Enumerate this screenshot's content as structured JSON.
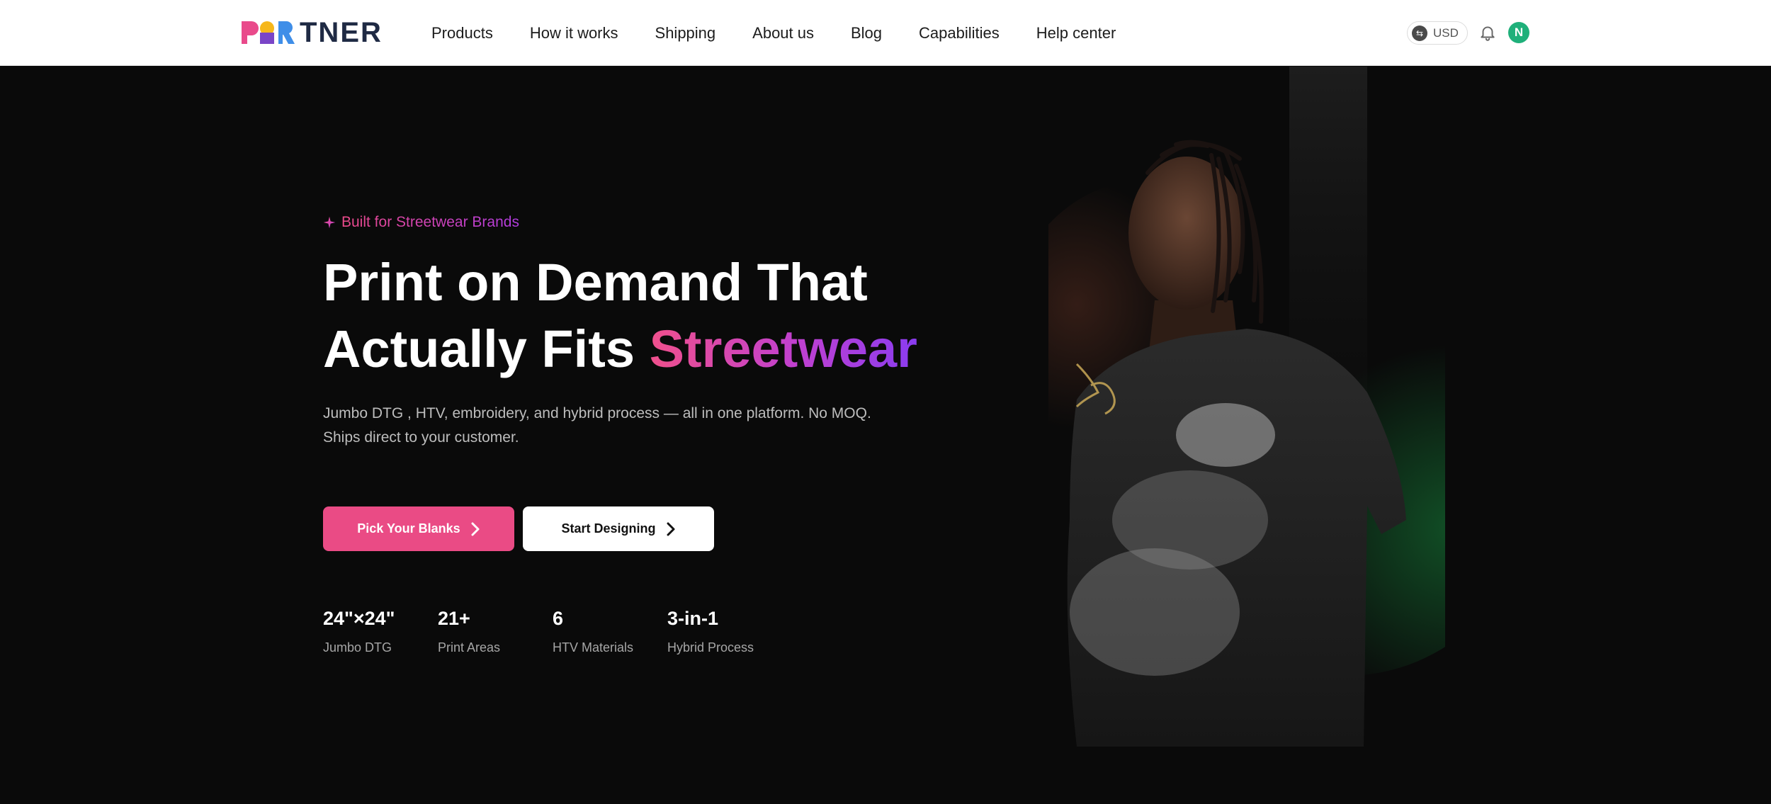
{
  "brand": {
    "name": "PARTNER",
    "wordmark": "TNER"
  },
  "nav": [
    "Products",
    "How it works",
    "Shipping",
    "About us",
    "Blog",
    "Capabilities",
    "Help center"
  ],
  "header_right": {
    "currency": "USD",
    "avatar_initial": "N"
  },
  "hero": {
    "badge": "Built for Streetwear Brands",
    "headline_line1": "Print on Demand That",
    "headline_line2_plain": "Actually Fits ",
    "headline_line2_accent": "Streetwear",
    "subtext_line1": "Jumbo DTG , HTV,  embroidery, and hybrid process — all in one platform. No MOQ.",
    "subtext_line2": "Ships direct to your customer.",
    "primary_cta": "Pick Your Blanks",
    "secondary_cta": "Start Designing",
    "stats": [
      {
        "value": "24\"×24\"",
        "label": "Jumbo DTG"
      },
      {
        "value": "21+",
        "label": "Print Areas"
      },
      {
        "value": "6",
        "label": "HTV Materials"
      },
      {
        "value": "3-in-1",
        "label": "Hybrid Process"
      }
    ]
  },
  "colors": {
    "accent_pink": "#ea4b85",
    "accent_purple": "#8a3cf0",
    "hero_bg": "#0a0a0a",
    "avatar_green": "#1fb07a"
  },
  "icons": [
    "sparkle-icon",
    "currency-exchange-icon",
    "bell-icon",
    "chevron-right-icon"
  ]
}
